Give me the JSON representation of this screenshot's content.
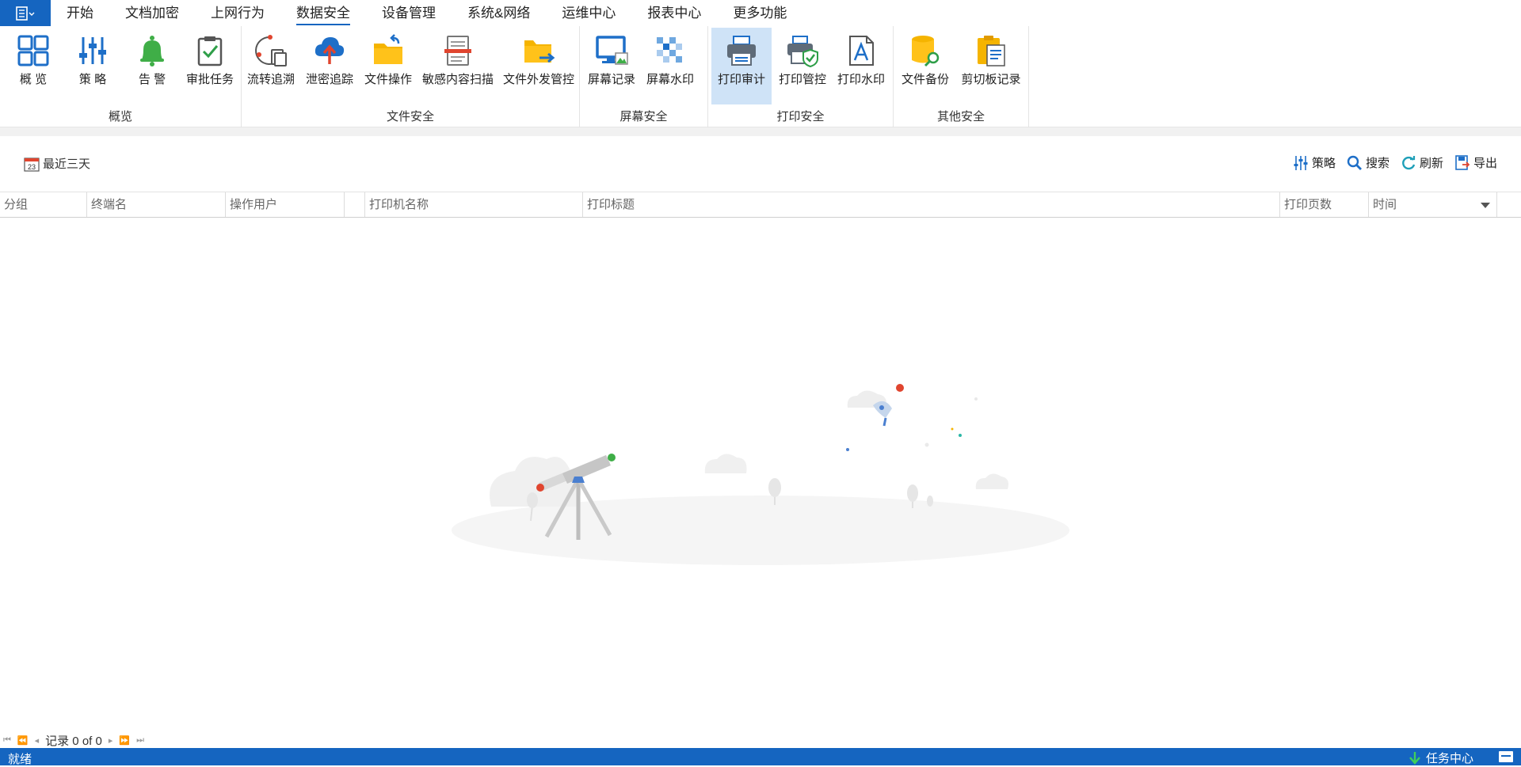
{
  "menu": {
    "tabs": [
      {
        "label": "开始"
      },
      {
        "label": "文档加密"
      },
      {
        "label": "上网行为"
      },
      {
        "label": "数据安全",
        "active": true
      },
      {
        "label": "设备管理"
      },
      {
        "label": "系统&网络"
      },
      {
        "label": "运维中心"
      },
      {
        "label": "报表中心"
      },
      {
        "label": "更多功能"
      }
    ]
  },
  "ribbon": {
    "groups": [
      {
        "label": "概览",
        "buttons": [
          {
            "label": "概 览",
            "icon": "overview-grid-icon"
          },
          {
            "label": "策 略",
            "icon": "policy-sliders-icon"
          },
          {
            "label": "告 警",
            "icon": "alarm-bell-icon"
          },
          {
            "label": "审批任务",
            "icon": "approval-clipboard-icon"
          }
        ]
      },
      {
        "label": "文件安全",
        "buttons": [
          {
            "label": "流转追溯",
            "icon": "flow-trace-icon"
          },
          {
            "label": "泄密追踪",
            "icon": "cloud-upload-icon"
          },
          {
            "label": "文件操作",
            "icon": "folder-operation-icon"
          },
          {
            "label": "敏感内容扫描",
            "icon": "document-scan-icon"
          },
          {
            "label": "文件外发管控",
            "icon": "folder-send-icon"
          }
        ]
      },
      {
        "label": "屏幕安全",
        "buttons": [
          {
            "label": "屏幕记录",
            "icon": "monitor-image-icon"
          },
          {
            "label": "屏幕水印",
            "icon": "watermark-grid-icon"
          }
        ]
      },
      {
        "label": "打印安全",
        "buttons": [
          {
            "label": "打印审计",
            "icon": "printer-icon",
            "selected": true
          },
          {
            "label": "打印管控",
            "icon": "printer-shield-icon"
          },
          {
            "label": "打印水印",
            "icon": "letter-a-document-icon"
          }
        ]
      },
      {
        "label": "其他安全",
        "buttons": [
          {
            "label": "文件备份",
            "icon": "database-search-icon"
          },
          {
            "label": "剪切板记录",
            "icon": "clipboard-icon"
          }
        ]
      }
    ]
  },
  "toolbar": {
    "date_range": "最近三天",
    "calendar_day": "23",
    "policy": "策略",
    "search": "搜索",
    "refresh": "刷新",
    "export": "导出"
  },
  "table": {
    "columns": [
      "分组",
      "终端名",
      "操作用户",
      "",
      "打印机名称",
      "打印标题",
      "打印页数",
      "时间"
    ],
    "rows": []
  },
  "pager": {
    "text": "记录 0 of 0"
  },
  "status": {
    "text": "就绪",
    "task_center": "任务中心"
  },
  "colors": {
    "accent": "#1565c0",
    "selected_bg": "#cfe3f7"
  }
}
